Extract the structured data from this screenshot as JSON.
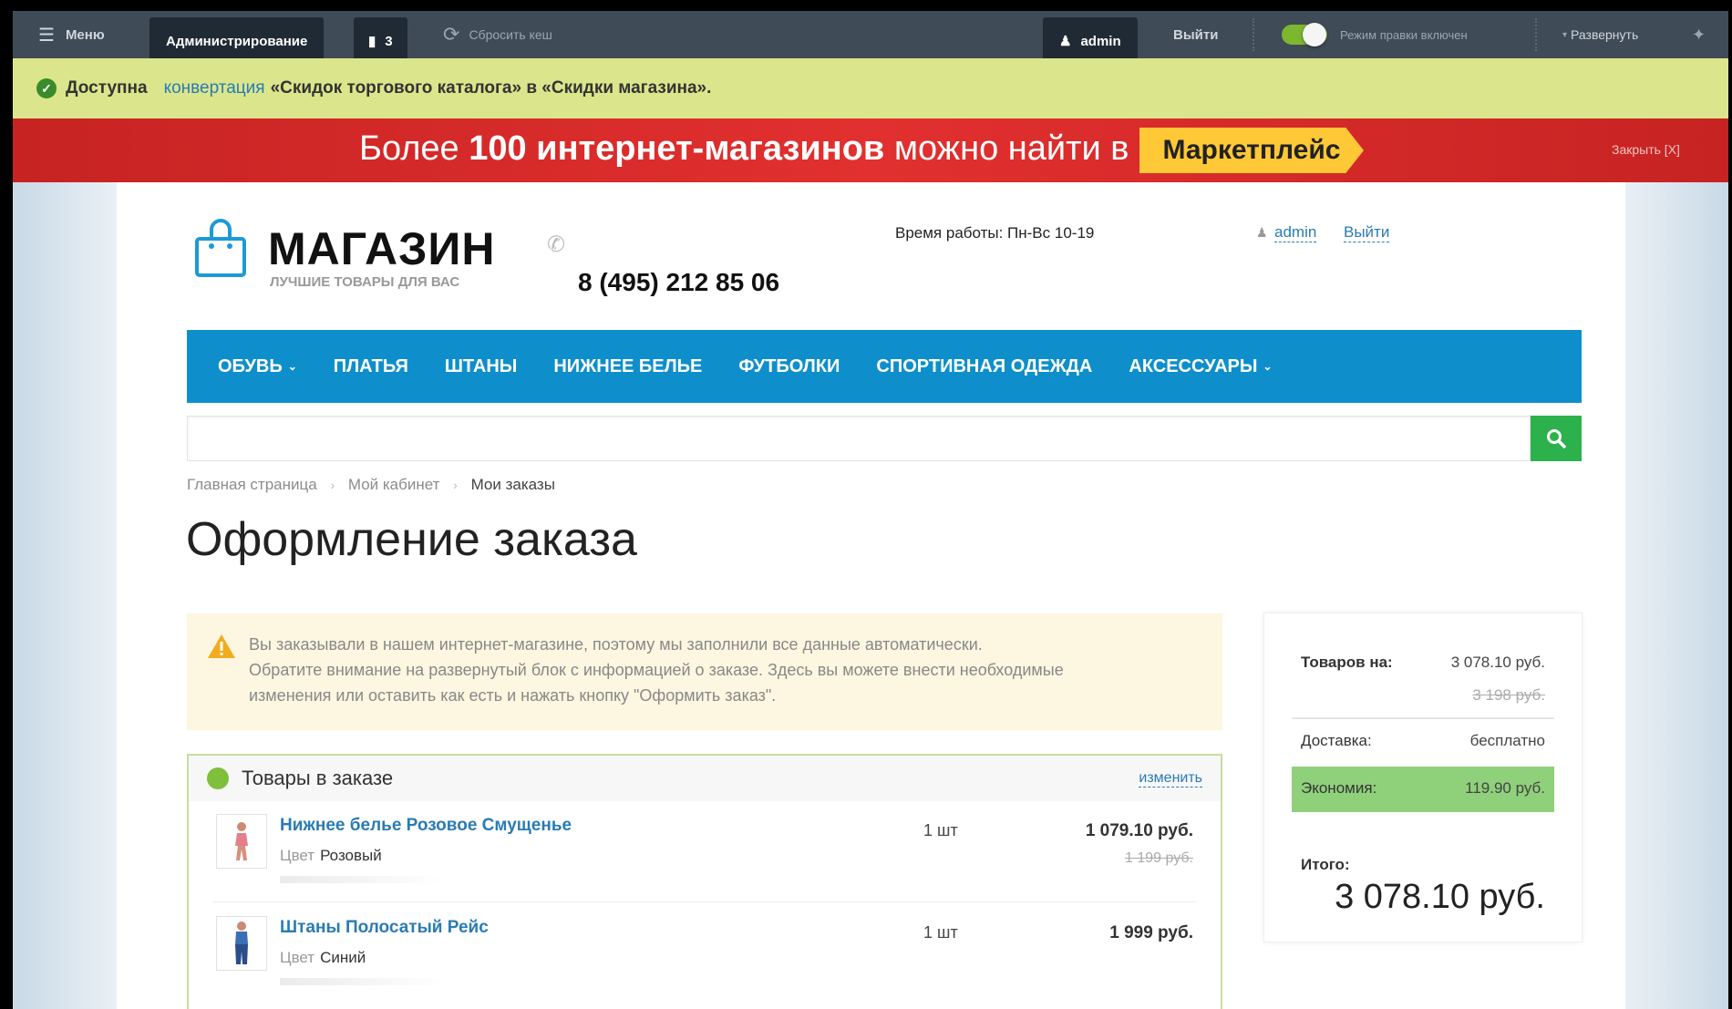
{
  "admin_panel": {
    "menu_label": "Меню",
    "admin_button": "Администрирование",
    "notifications_count": "3",
    "clear_cache": "Сбросить кеш",
    "user": "admin",
    "logout": "Выйти",
    "edit_mode": "Режим правки включен",
    "expand": "Развернуть"
  },
  "notice": {
    "prefix": "Доступна",
    "link": "конвертация",
    "rest": "«Скидок торгового каталога» в «Скидки магазина»."
  },
  "banner": {
    "text_before": "Более",
    "text_bold": "100 интернет-магазинов",
    "text_after": "можно найти в",
    "marketplace": "Маркетплейс",
    "close": "Закрыть [X]"
  },
  "header": {
    "brand": "МАГАЗИН",
    "tagline": "ЛУЧШИЕ ТОВАРЫ ДЛЯ ВАС",
    "phone": "8 (495) 212 85 06",
    "hours": "Время работы: Пн-Вс 10-19",
    "user": "admin",
    "logout": "Выйти"
  },
  "nav": {
    "items": [
      {
        "label": "ОБУВЬ",
        "has_dropdown": true
      },
      {
        "label": "ПЛАТЬЯ",
        "has_dropdown": false
      },
      {
        "label": "ШТАНЫ",
        "has_dropdown": false
      },
      {
        "label": "НИЖНЕЕ БЕЛЬЕ",
        "has_dropdown": false
      },
      {
        "label": "ФУТБОЛКИ",
        "has_dropdown": false
      },
      {
        "label": "СПОРТИВНАЯ ОДЕЖДА",
        "has_dropdown": false
      },
      {
        "label": "АКСЕССУАРЫ",
        "has_dropdown": true
      }
    ]
  },
  "search": {
    "value": "",
    "placeholder": ""
  },
  "breadcrumb": {
    "items": [
      "Главная страница",
      "Мой кабинет",
      "Мои заказы"
    ]
  },
  "page_title": "Оформление заказа",
  "warning": {
    "line1": "Вы заказывали в нашем интернет-магазине, поэтому мы заполнили все данные автоматически.",
    "line2": "Обратите внимание на развернутый блок с информацией о заказе. Здесь вы можете внести необходимые",
    "line3": "изменения или оставить как есть и нажать кнопку \"Оформить заказ\"."
  },
  "order_items": {
    "title": "Товары в заказе",
    "edit": "изменить",
    "rows": [
      {
        "name": "Нижнее белье Розовое Смущенье",
        "prop_label": "Цвет",
        "prop_value": "Розовый",
        "qty": "1 шт",
        "price": "1 079.10 руб.",
        "old_price": "1 199 руб."
      },
      {
        "name": "Штаны Полосатый Рейс",
        "prop_label": "Цвет",
        "prop_value": "Синий",
        "qty": "1 шт",
        "price": "1 999 руб.",
        "old_price": ""
      }
    ]
  },
  "summary": {
    "goods_label": "Товаров на:",
    "goods_value": "3 078.10 руб.",
    "goods_old": "3 198 руб.",
    "delivery_label": "Доставка:",
    "delivery_value": "бесплатно",
    "savings_label": "Экономия:",
    "savings_value": "119.90 руб.",
    "total_label": "Итого:",
    "total_value": "3 078.10 руб."
  },
  "colors": {
    "admin_bar": "#3f4b57",
    "notice": "#dbe68c",
    "banner": "#e1302f",
    "marketplace": "#ffc837",
    "nav": "#0e8fcc",
    "search_button": "#2db14c",
    "link": "#2a7bb3",
    "savings_highlight": "#8fd07b"
  }
}
